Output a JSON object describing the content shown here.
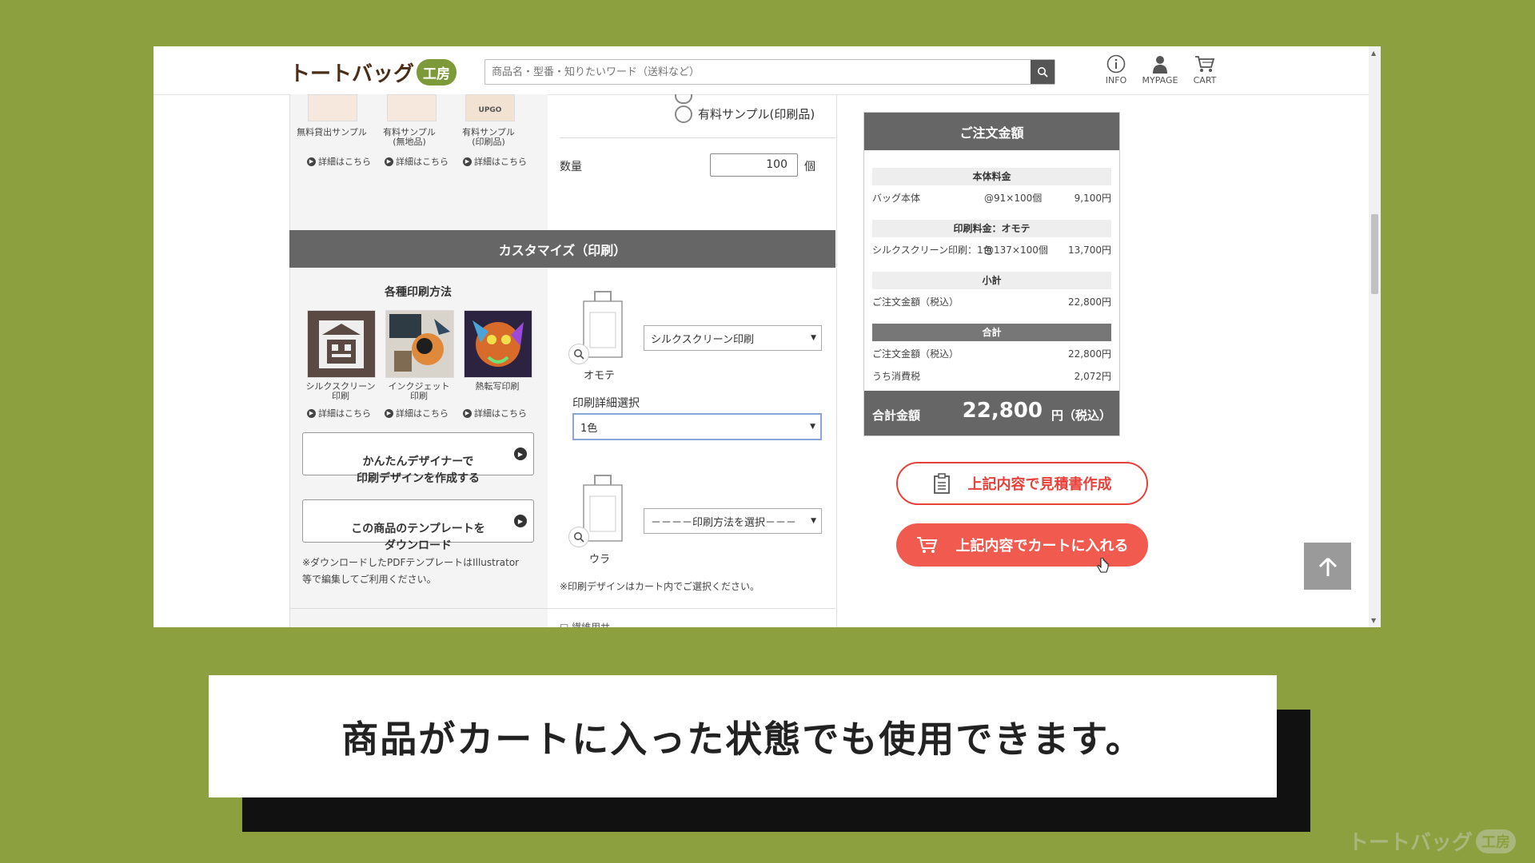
{
  "header": {
    "logo_text": "トートバッグ",
    "logo_badge": "工房",
    "search_placeholder": "商品名・型番・知りたいワード（送料など）",
    "icons": [
      {
        "label": "INFO",
        "icon": "info-icon"
      },
      {
        "label": "MYPAGE",
        "icon": "user-icon"
      },
      {
        "label": "CART",
        "icon": "cart-icon"
      }
    ]
  },
  "sample": {
    "items": [
      {
        "label": "無料貸出サンプル"
      },
      {
        "label": "有料サンプル\n(無地品)"
      },
      {
        "label": "有料サンプル\n(印刷品)"
      }
    ],
    "detail_label": "詳細はこちら",
    "radio_label": "有料サンプル(印刷品)",
    "quantity_label": "数量",
    "quantity_value": "100",
    "quantity_unit": "個"
  },
  "customize": {
    "title": "カスタマイズ（印刷）",
    "methods_title": "各種印刷方法",
    "methods": [
      {
        "label": "シルクスクリーン\n印刷"
      },
      {
        "label": "インクジェット\n印刷"
      },
      {
        "label": "熱転写印刷"
      }
    ],
    "designer_button": "かんたんデザイナーで\n印刷デザインを作成する",
    "template_button": "この商品のテンプレートを\nダウンロード",
    "template_note": "※ダウンロードしたPDFテンプレートはIllustrator\n等で編集してご利用ください。",
    "front_label": "オモテ",
    "front_method": "シルクスクリーン印刷",
    "detail_select_label": "印刷詳細選択",
    "detail_select_value": "1色",
    "back_label": "ウラ",
    "back_method": "－－－－印刷方法を選択－－－",
    "cart_note": "※印刷デザインはカート内でご選択ください。",
    "bottom_partial": "□ 繊維用サ…"
  },
  "order": {
    "title": "ご注文金額",
    "sections": [
      {
        "header": "本体料金",
        "rows": [
          {
            "name": "バッグ本体",
            "unit": "@91×100個",
            "amount": "9,100円"
          }
        ]
      },
      {
        "header": "印刷料金：オモテ",
        "rows": [
          {
            "name": "シルクスクリーン印刷：1色",
            "unit": "@137×100個",
            "amount": "13,700円"
          }
        ]
      },
      {
        "header": "小計",
        "rows": [
          {
            "name": "ご注文金額（税込）",
            "unit": "",
            "amount": "22,800円"
          }
        ]
      },
      {
        "header": "合計",
        "rows": [
          {
            "name": "ご注文金額（税込）",
            "unit": "",
            "amount": "22,800円"
          },
          {
            "name": "うち消費税",
            "unit": "",
            "amount": "2,072円"
          }
        ]
      }
    ],
    "total_label": "合計金額",
    "total_value": "22,800",
    "total_suffix": "円（税込）"
  },
  "buttons": {
    "estimate": "上記内容で見積書作成",
    "cart": "上記内容でカートに入れる"
  },
  "caption": "商品がカートに入った状態でも使用できます。",
  "watermark": {
    "text": "トートバッグ",
    "badge": "工房"
  },
  "colors": {
    "accent": "#f05a4f",
    "background": "#8ca040",
    "panel": "#666666"
  }
}
